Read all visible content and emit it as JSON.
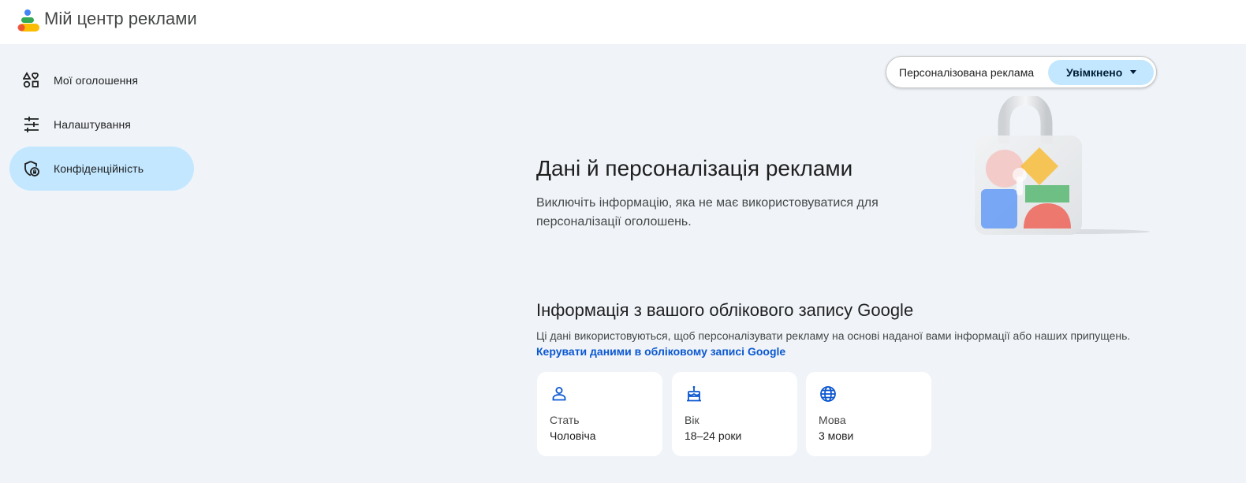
{
  "app": {
    "title": "Мій центр реклами"
  },
  "sidebar": {
    "items": [
      {
        "label": "Мої оголошення",
        "icon": "my-ads-icon"
      },
      {
        "label": "Налаштування",
        "icon": "sliders-icon"
      },
      {
        "label": "Конфіденційність",
        "icon": "privacy-shield-icon",
        "active": true
      }
    ]
  },
  "personalization": {
    "label": "Персоналізована реклама",
    "state": "Увімкнено"
  },
  "hero": {
    "title": "Дані й персоналізація реклами",
    "description": "Виключіть інформацію, яка не має використовуватися для персоналізації оголошень."
  },
  "account_section": {
    "title": "Інформація з вашого облікового запису Google",
    "description": "Ці дані використовуються, щоб персоналізувати рекламу на основі наданої вами інформації або наших припущень.",
    "link": "Керувати даними в обліковому записі Google",
    "cards": [
      {
        "label": "Стать",
        "value": "Чоловіча",
        "icon": "person-icon"
      },
      {
        "label": "Вік",
        "value": "18–24 роки",
        "icon": "cake-icon"
      },
      {
        "label": "Мова",
        "value": "3 мови",
        "icon": "globe-icon"
      }
    ]
  },
  "colors": {
    "accent": "#c2e7ff",
    "link": "#0b57d0",
    "background": "#f0f4f9"
  }
}
